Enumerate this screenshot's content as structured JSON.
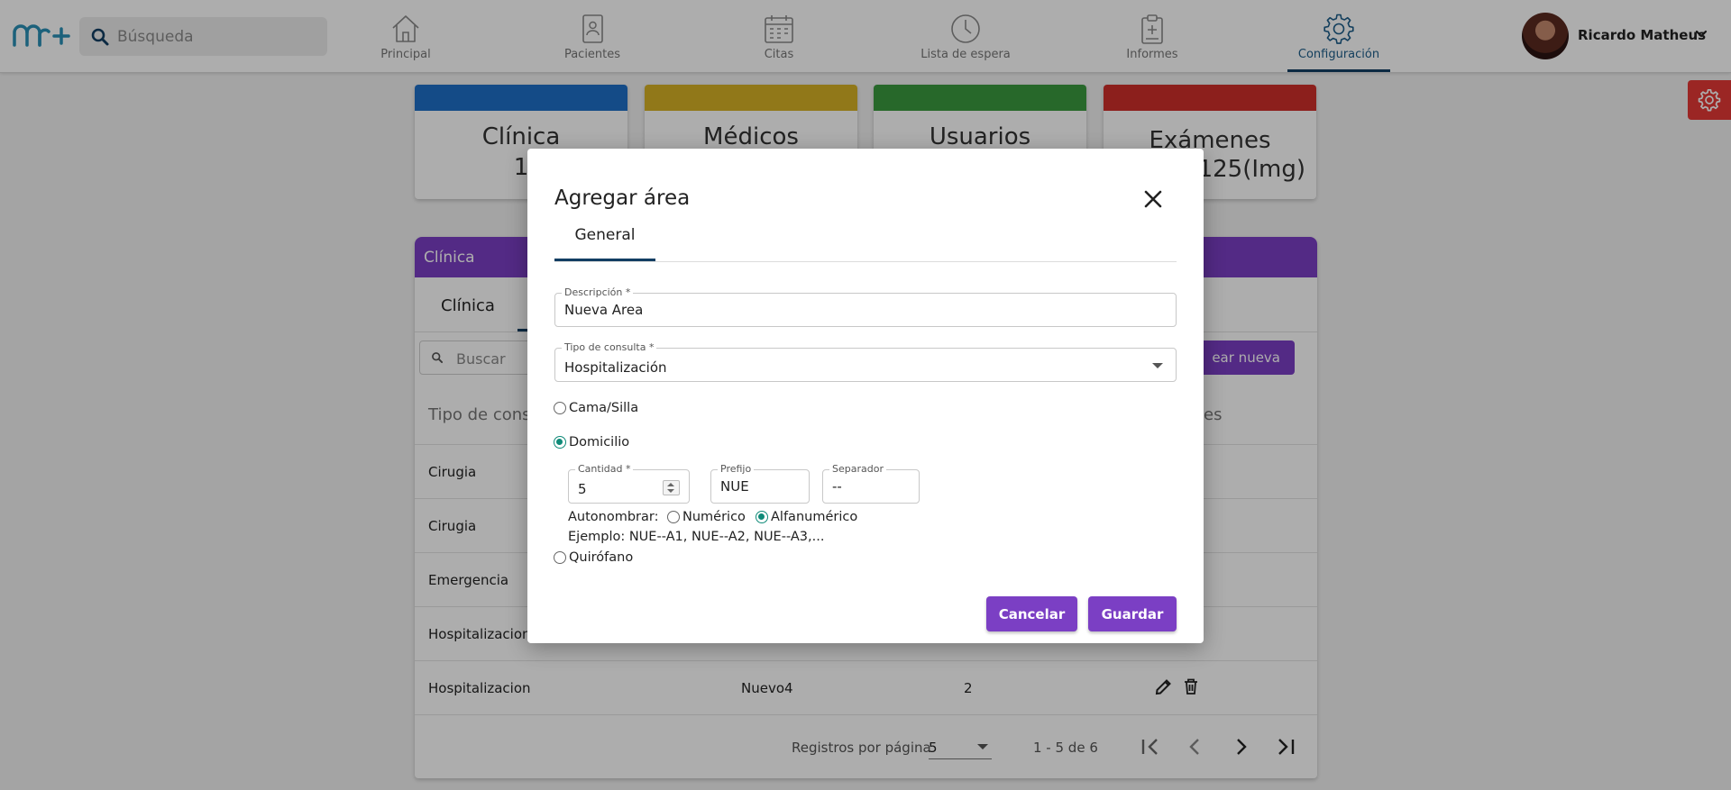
{
  "search": {
    "placeholder": "Búsqueda"
  },
  "nav": {
    "items": [
      {
        "label": "Principal",
        "icon": "home-icon"
      },
      {
        "label": "Pacientes",
        "icon": "patient-file-icon"
      },
      {
        "label": "Citas",
        "icon": "calendar-icon"
      },
      {
        "label": "Lista de espera",
        "icon": "clock-icon"
      },
      {
        "label": "Informes",
        "icon": "clipboard-icon"
      },
      {
        "label": "Configuración",
        "icon": "gear-icon",
        "active": true
      }
    ]
  },
  "user": {
    "name": "Ricardo Matheus"
  },
  "stats": [
    {
      "title": "Clínica",
      "value": "1",
      "color": "#1e6fc8"
    },
    {
      "title": "Médicos",
      "value": "",
      "color": "#d6b226"
    },
    {
      "title": "Usuarios",
      "value": "",
      "color": "#3a9a3f"
    },
    {
      "title": "Exámenes",
      "value": "/125(Img)",
      "color": "#cf2e2a"
    }
  ],
  "panel": {
    "header": "Clínica",
    "tab": "Clínica",
    "search_placeholder": "Buscar",
    "new_button": "ear nueva",
    "columns": [
      "Tipo de consu",
      "es"
    ],
    "rows": [
      {
        "type": "Cirugia"
      },
      {
        "type": "Cirugia"
      },
      {
        "type": "Emergencia"
      },
      {
        "type": "Hospitalizacion"
      },
      {
        "type": "Hospitalizacion",
        "name": "Nuevo4",
        "qty": "2"
      }
    ],
    "pager": {
      "label": "Registros por página",
      "size": "5",
      "range": "1 - 5 de 6"
    }
  },
  "modal": {
    "title": "Agregar área",
    "tab": "General",
    "descripcion": {
      "label": "Descripción *",
      "value": "Nueva Area"
    },
    "tipo_consulta": {
      "label": "Tipo de consulta *",
      "value": "Hospitalización"
    },
    "options": {
      "cama": "Cama/Silla",
      "domicilio": "Domicilio",
      "quirofano": "Quirófano"
    },
    "cantidad": {
      "label": "Cantidad *",
      "value": "5"
    },
    "prefijo": {
      "label": "Prefijo",
      "value": "NUE"
    },
    "separador": {
      "label": "Separador",
      "value": "--"
    },
    "autonombrar": {
      "label": "Autonombrar:",
      "numerico": "Numérico",
      "alfanumerico": "Alfanumérico"
    },
    "ejemplo": "Ejemplo: NUE--A1, NUE--A2, NUE--A3,...",
    "cancel": "Cancelar",
    "save": "Guardar"
  },
  "colors": {
    "accent": "#7b3fc4",
    "active_nav": "#123e63",
    "radio_checked": "#0f8a78",
    "settings_fab": "#e53935"
  }
}
